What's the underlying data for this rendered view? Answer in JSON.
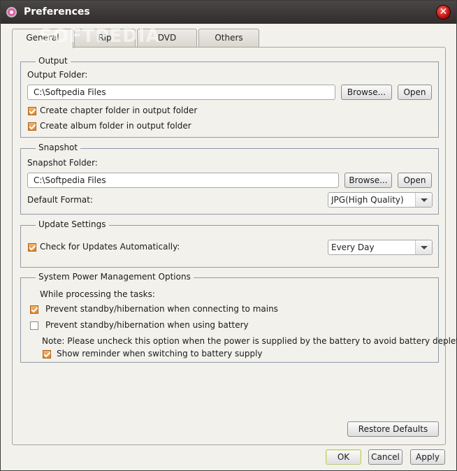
{
  "window": {
    "title": "Preferences",
    "icon": "disc-icon",
    "close_icon": "close-icon"
  },
  "watermark": "SOFTPEDIA",
  "tabs": [
    {
      "label": "General",
      "active": true
    },
    {
      "label": "Rip",
      "active": false
    },
    {
      "label": "DVD",
      "active": false
    },
    {
      "label": "Others",
      "active": false
    }
  ],
  "output": {
    "group_title": "Output",
    "folder_label": "Output Folder:",
    "folder_value": "C:\\Softpedia Files",
    "browse_label": "Browse...",
    "open_label": "Open",
    "chapter_folder_label": "Create chapter folder in output folder",
    "chapter_folder_checked": true,
    "album_folder_label": "Create album folder in output folder",
    "album_folder_checked": true
  },
  "snapshot": {
    "group_title": "Snapshot",
    "folder_label": "Snapshot Folder:",
    "folder_value": "C:\\Softpedia Files",
    "browse_label": "Browse...",
    "open_label": "Open",
    "format_label": "Default Format:",
    "format_value": "JPG(High Quality)"
  },
  "update": {
    "group_title": "Update Settings",
    "check_label": "Check for Updates Automatically:",
    "check_checked": true,
    "frequency_value": "Every Day"
  },
  "power": {
    "group_title": "System Power Management Options",
    "while_label": "While processing the tasks:",
    "mains_label": "Prevent standby/hibernation when connecting to mains",
    "mains_checked": true,
    "battery_label": "Prevent standby/hibernation when using battery",
    "battery_checked": false,
    "note": "Note: Please uncheck this option when the power is supplied by the battery to avoid battery depletion.",
    "reminder_label": "Show reminder when switching to battery supply",
    "reminder_checked": true
  },
  "buttons": {
    "restore_defaults": "Restore Defaults",
    "ok": "OK",
    "cancel": "Cancel",
    "apply": "Apply"
  },
  "colors": {
    "accent_checkbox": "#e08a2c",
    "titlebar": "#3a3736"
  }
}
